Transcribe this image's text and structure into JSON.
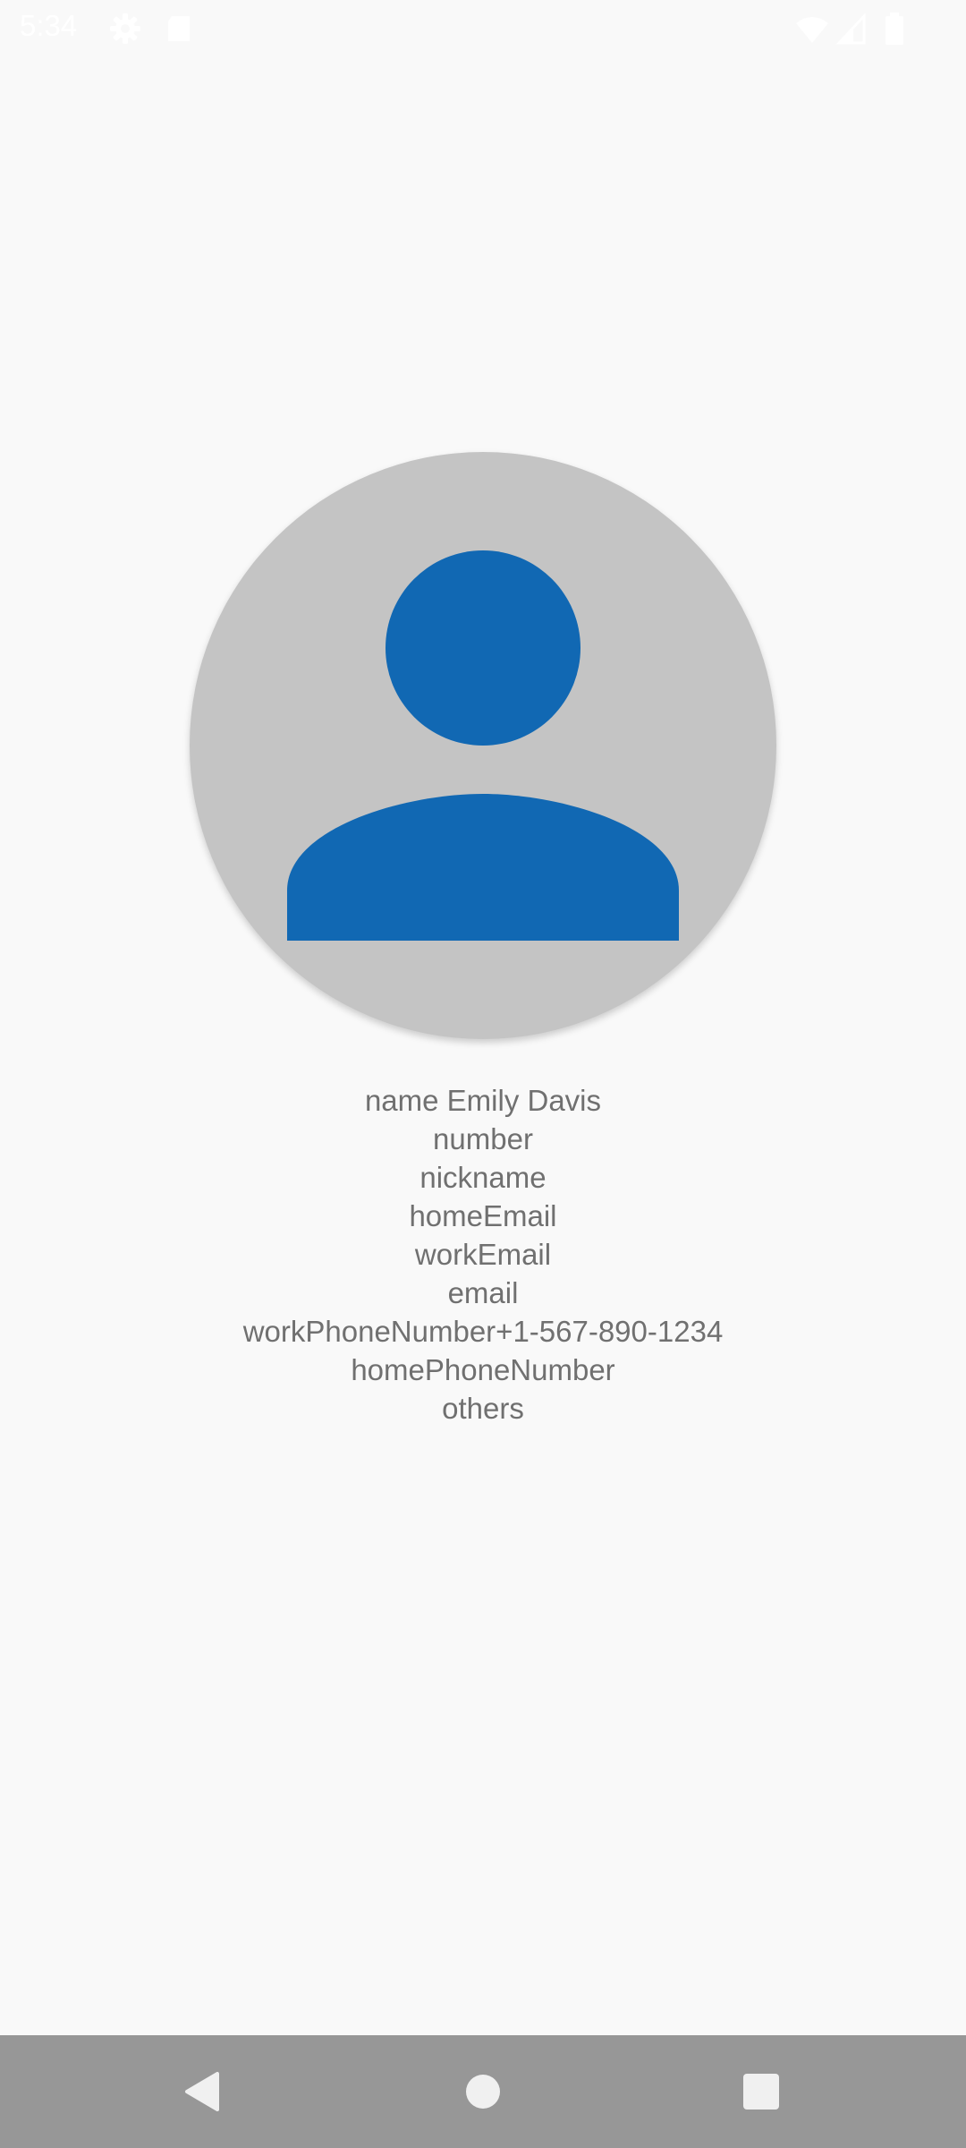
{
  "status_bar": {
    "time": "5:34",
    "icons": [
      "settings-icon",
      "sd-card-icon",
      "wifi-icon",
      "cellular-signal-icon",
      "battery-icon"
    ]
  },
  "contact": {
    "avatar_icon": "person-icon",
    "avatar_bg_color": "#c4c4c4",
    "avatar_fg_color": "#1168b3",
    "name_line": "name Emily Davis",
    "number_line": "number",
    "nickname_line": "nickname",
    "home_email_line": "homeEmail",
    "work_email_line": "workEmail",
    "email_line": "email",
    "work_phone_line": "workPhoneNumber+1-567-890-1234",
    "home_phone_line": "homePhoneNumber",
    "others_line": "others"
  },
  "nav_bar": {
    "buttons": [
      "back-icon",
      "home-icon",
      "recents-icon"
    ],
    "color": "#979797"
  }
}
